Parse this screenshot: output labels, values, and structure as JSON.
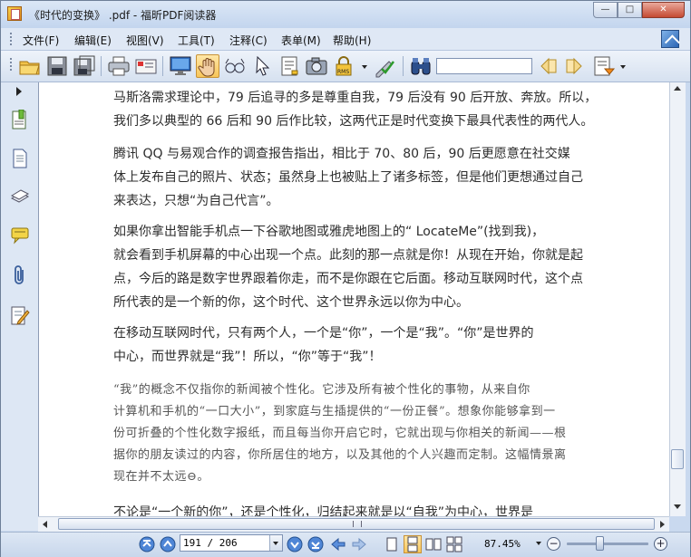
{
  "window": {
    "title": "《时代的变换》 .pdf - 福昕PDF阅读器",
    "min_symbol": "—",
    "max_symbol": "□",
    "close_symbol": "✕"
  },
  "menu": [
    {
      "label": "文件(F)"
    },
    {
      "label": "编辑(E)"
    },
    {
      "label": "视图(V)"
    },
    {
      "label": "工具(T)"
    },
    {
      "label": "注释(C)"
    },
    {
      "label": "表单(M)"
    },
    {
      "label": "帮助(H)"
    }
  ],
  "toolbar": {
    "icons": [
      "open-folder-icon",
      "save-icon",
      "save-as-icon",
      "print-icon",
      "email-icon",
      "fullscreen-monitor-icon",
      "hand-tool-icon",
      "zoom-glasses-icon",
      "select-arrow-icon",
      "text-select-icon",
      "snapshot-camera-icon",
      "rms-lock-icon",
      "sign-check-icon",
      "find-binoculars-icon",
      "prev-result-icon",
      "next-result-icon",
      "highlight-text-icon"
    ],
    "search_value": ""
  },
  "document": {
    "paragraphs": [
      {
        "style": "sans",
        "lines": [
          "马斯洛需求理论中，79 后追寻的多是尊重自我，79 后没有 90 后开放、奔放。所以，",
          "我们多以典型的 66 后和 90 后作比较，这两代正是时代变换下最具代表性的两代人。"
        ]
      },
      {
        "style": "sans",
        "lines": [
          "    腾讯 QQ 与易观合作的调查报告指出，相比于 70、80 后，90 后更愿意在社交媒",
          "体上发布自己的照片、状态；虽然身上也被贴上了诸多标签，但是他们更想通过自己",
          "来表达，只想“为自己代言”。"
        ]
      },
      {
        "style": "sans",
        "lines": [
          "    如果你拿出智能手机点一下谷歌地图或雅虎地图上的“ LocateMe”(找到我)，",
          "就会看到手机屏幕的中心出现一个点。此刻的那一点就是你！从现在开始，你就是起",
          "点，今后的路是数字世界跟着你走，而不是你跟在它后面。移动互联网时代，这个点",
          "所代表的是一个新的你，这个时代、这个世界永远以你为中心。"
        ]
      },
      {
        "style": "sans",
        "lines": [
          "    在移动互联网时代，只有两个人，一个是“你”，一个是“我”。“你”是世界的",
          "中心，而世界就是“我”！所以，“你”等于“我”！"
        ]
      },
      {
        "style": "serif",
        "lines": [
          "    “我”的概念不仅指你的新闻被个性化。它涉及所有被个性化的事物，从来自你",
          "计算机和手机的“一口大小”，到家庭与生插提供的“一份正餐”。想象你能够拿到一",
          "份可折叠的个性化数字报纸，而且每当你开启它时，它就出现与你相关的新闻——根",
          "据你的朋友读过的内容，你所居住的地方，以及其他的个人兴趣而定制。这幅情景离",
          "现在并不太远⊖。"
        ]
      },
      {
        "style": "sans",
        "lines": [
          "    不论是“一个新的你”，还是个性化，归结起来就是以“自我”为中心，世界是"
        ]
      }
    ]
  },
  "statusbar": {
    "page_value": "191 / 206",
    "zoom": "87.45%",
    "zoom_fraction": 0.4,
    "zoom_out_symbol": "−",
    "zoom_in_symbol": "+"
  }
}
